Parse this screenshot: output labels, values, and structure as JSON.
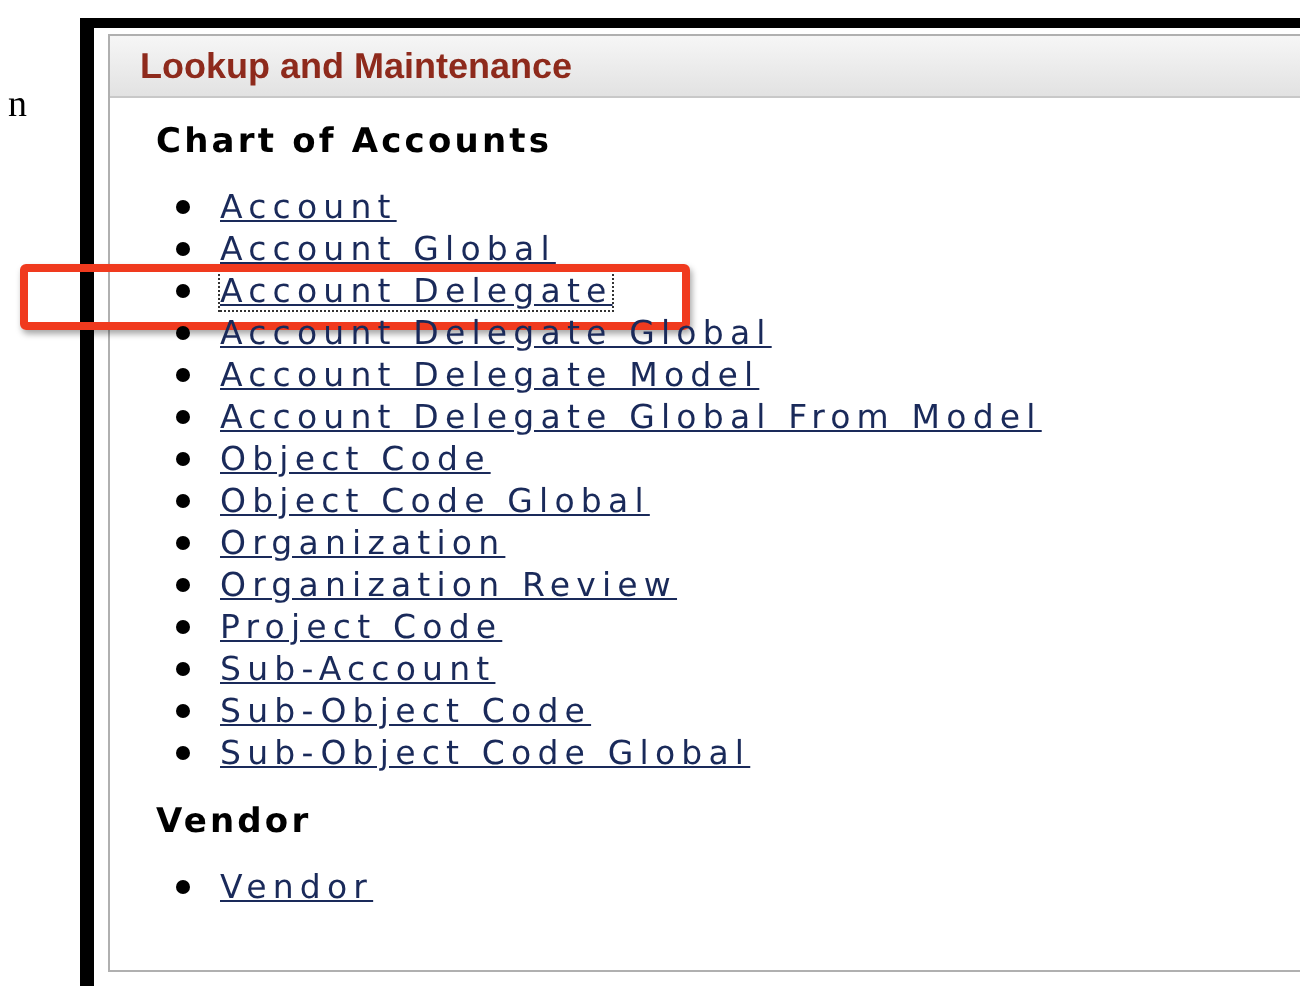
{
  "margin_text": "n",
  "panel": {
    "title": "Lookup and Maintenance"
  },
  "sections": [
    {
      "heading": "Chart of Accounts",
      "items": [
        {
          "label": "Account",
          "focused": false,
          "highlighted": false
        },
        {
          "label": "Account Global",
          "focused": false,
          "highlighted": false
        },
        {
          "label": "Account Delegate",
          "focused": true,
          "highlighted": true
        },
        {
          "label": "Account Delegate Global",
          "focused": false,
          "highlighted": false
        },
        {
          "label": "Account Delegate Model",
          "focused": false,
          "highlighted": false
        },
        {
          "label": "Account Delegate Global From Model",
          "focused": false,
          "highlighted": false
        },
        {
          "label": "Object Code",
          "focused": false,
          "highlighted": false
        },
        {
          "label": "Object Code Global",
          "focused": false,
          "highlighted": false
        },
        {
          "label": "Organization",
          "focused": false,
          "highlighted": false
        },
        {
          "label": "Organization Review",
          "focused": false,
          "highlighted": false
        },
        {
          "label": "Project Code",
          "focused": false,
          "highlighted": false
        },
        {
          "label": "Sub-Account",
          "focused": false,
          "highlighted": false
        },
        {
          "label": "Sub-Object Code",
          "focused": false,
          "highlighted": false
        },
        {
          "label": "Sub-Object Code Global",
          "focused": false,
          "highlighted": false
        }
      ]
    },
    {
      "heading": "Vendor",
      "items": [
        {
          "label": "Vendor",
          "focused": false,
          "highlighted": false
        }
      ]
    }
  ]
}
